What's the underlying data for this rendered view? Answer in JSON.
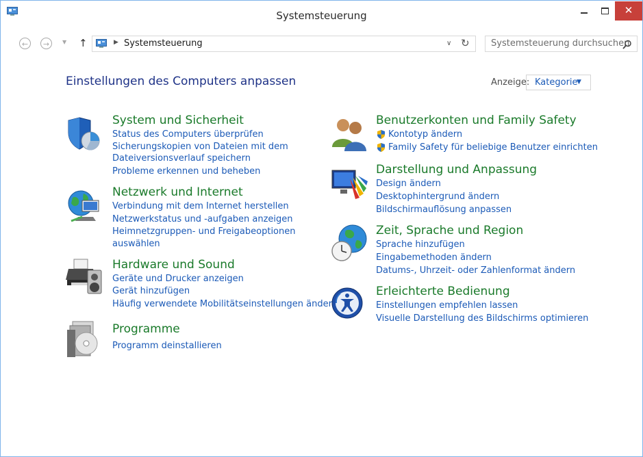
{
  "window": {
    "title": "Systemsteuerung",
    "close_glyph": "✕"
  },
  "navbar": {
    "back_glyph": "←",
    "forward_glyph": "→",
    "dropdown_glyph": "▼",
    "up_glyph": "↑",
    "breadcrumb": "Systemsteuerung",
    "breadcrumb_sep": "▶",
    "addr_dropdown_glyph": "∨",
    "refresh_glyph": "↻",
    "search_placeholder": "Systemsteuerung durchsuchen"
  },
  "content": {
    "title": "Einstellungen des Computers anpassen",
    "view_label": "Anzeige:",
    "view_value": "Kategorie",
    "view_arrow": "▼"
  },
  "categories_left": [
    {
      "title": "System und Sicherheit",
      "icon": "shield-pc-icon",
      "links": [
        "Status des Computers überprüfen",
        "Sicherungskopien von Dateien mit dem",
        "Dateiversionsverlauf speichern",
        "Probleme erkennen und beheben"
      ]
    },
    {
      "title": "Netzwerk und Internet",
      "icon": "network-globe-icon",
      "links": [
        "Verbindung mit dem Internet herstellen",
        "Netzwerkstatus und -aufgaben anzeigen",
        "Heimnetzgruppen- und Freigabeoptionen",
        "auswählen"
      ]
    },
    {
      "title": "Hardware und Sound",
      "icon": "printer-speaker-icon",
      "links": [
        "Geräte und Drucker anzeigen",
        "Gerät hinzufügen",
        "Häufig verwendete Mobilitätseinstellungen ändern"
      ]
    },
    {
      "title": "Programme",
      "icon": "programs-disc-icon",
      "links": [
        "Programm deinstallieren"
      ]
    }
  ],
  "categories_right": [
    {
      "title": "Benutzerkonten und Family Safety",
      "icon": "users-icon",
      "links": [
        "Kontotyp ändern",
        "Family Safety für beliebige Benutzer einrichten"
      ]
    },
    {
      "title": "Darstellung und Anpassung",
      "icon": "monitor-palette-icon",
      "links": [
        "Design ändern",
        "Desktophintergrund ändern",
        "Bildschirmauflösung anpassen"
      ]
    },
    {
      "title": "Zeit, Sprache und Region",
      "icon": "globe-clock-icon",
      "links": [
        "Sprache hinzufügen",
        "Eingabemethoden ändern",
        "Datums-, Uhrzeit- oder Zahlenformat ändern"
      ]
    },
    {
      "title": "Erleichterte Bedienung",
      "icon": "ease-of-access-icon",
      "links": [
        "Einstellungen empfehlen lassen",
        "Visuelle Darstellung des Bildschirms optimieren"
      ]
    }
  ]
}
